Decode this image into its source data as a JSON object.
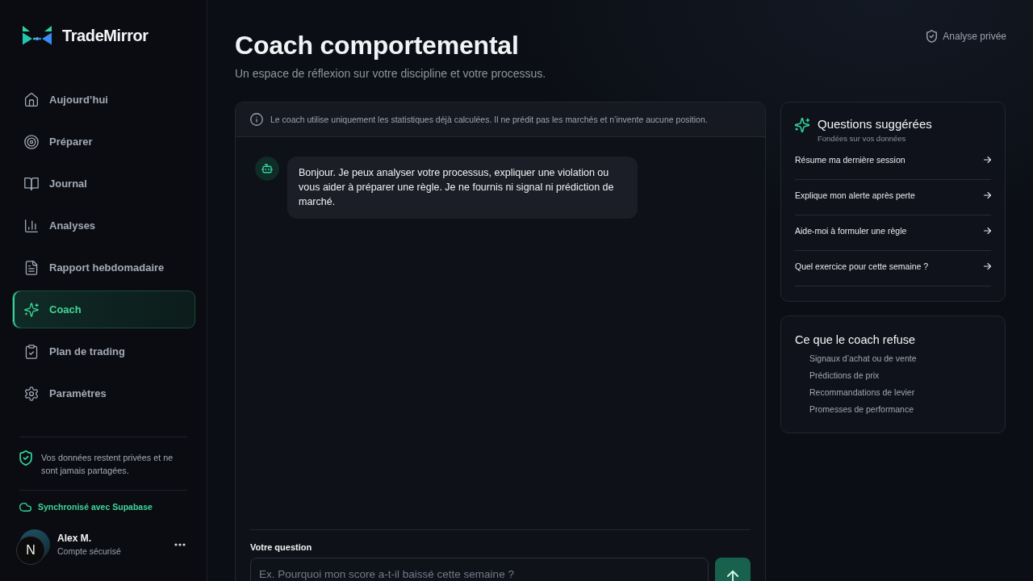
{
  "sidebar": {
    "brand": "TradeMirror",
    "nav": [
      {
        "label": "Aujourd’hui",
        "selected": false
      },
      {
        "label": "Préparer",
        "selected": false
      },
      {
        "label": "Journal",
        "selected": false
      },
      {
        "label": "Analyses",
        "selected": false
      },
      {
        "label": "Rapport hebdomadaire",
        "selected": false
      },
      {
        "label": "Coach",
        "selected": true
      },
      {
        "label": "Plan de trading",
        "selected": false
      },
      {
        "label": "Paramètres",
        "selected": false
      }
    ],
    "privacy_note": "Vos données restent privées et ne sont jamais partagées.",
    "sync_status": "Synchronisé avec Supabase",
    "user": {
      "name": "Alex M.",
      "status": "Compte sécurisé"
    }
  },
  "floating_badge": {
    "label": "N"
  },
  "header": {
    "title": "Coach comportemental",
    "subtitle": "Un espace de réflexion sur votre discipline et votre processus.",
    "privacy_badge": "Analyse privée"
  },
  "chat": {
    "notice": "Le coach utilise uniquement les statistiques déjà calculées. Il ne prédit pas les marchés et n’invente aucune position.",
    "messages": [
      {
        "kind": "coach",
        "text": "Bonjour. Je peux analyser votre processus, expliquer une violation ou vous aider à préparer une règle. Je ne fournis ni signal ni prédiction de marché."
      }
    ],
    "composer": {
      "label": "Votre question",
      "placeholder": "Ex. Pourquoi mon score a-t-il baissé cette semaine ?"
    }
  },
  "suggestions": {
    "title": "Questions suggérées",
    "subtitle": "Fondées sur vos données",
    "items": [
      "Résume ma dernière session",
      "Explique mon alerte après perte",
      "Aide-moi à formuler une règle",
      "Quel exercice pour cette semaine ?"
    ]
  },
  "refusals": {
    "title": "Ce que le coach refuse",
    "items": [
      "Signaux d’achat ou de vente",
      "Prédictions de prix",
      "Recommandations de levier",
      "Promesses de performance"
    ]
  }
}
